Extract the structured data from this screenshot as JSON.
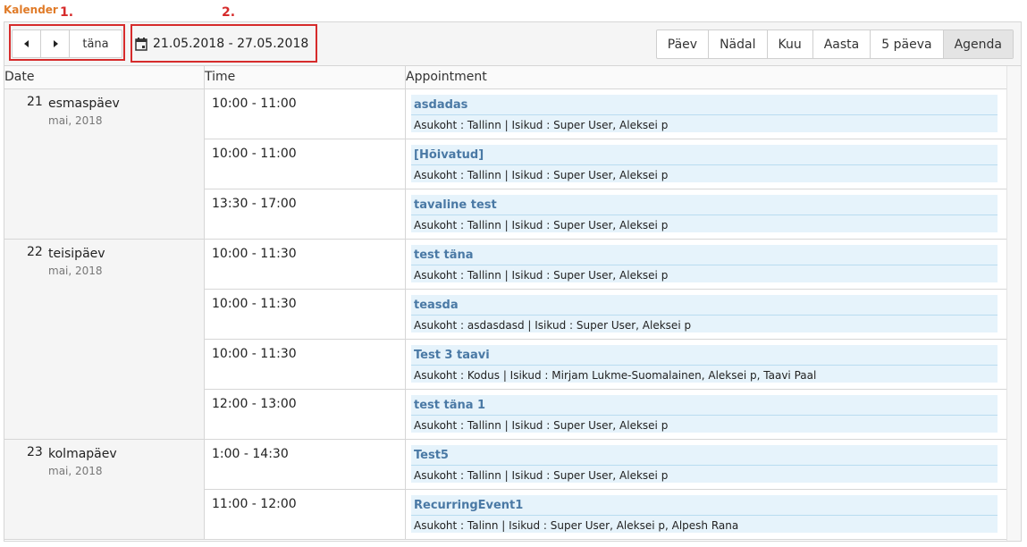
{
  "app_title": "Kalender",
  "annotations": {
    "label1": "1.",
    "label2": "2."
  },
  "toolbar": {
    "prev_icon": "triangle-left-icon",
    "next_icon": "triangle-right-icon",
    "today_label": "täna",
    "date_range": "21.05.2018 - 27.05.2018",
    "views": [
      {
        "label": "Päev",
        "active": false
      },
      {
        "label": "Nädal",
        "active": false
      },
      {
        "label": "Kuu",
        "active": false
      },
      {
        "label": "Aasta",
        "active": false
      },
      {
        "label": "5 päeva",
        "active": false
      },
      {
        "label": "Agenda",
        "active": true
      }
    ]
  },
  "columns": {
    "date": "Date",
    "time": "Time",
    "appointment": "Appointment"
  },
  "days": [
    {
      "num": "21",
      "name": "esmaspäev",
      "month": "mai, 2018",
      "events": [
        {
          "time": "10:00 - 11:00",
          "title": "asdadas",
          "desc": "Asukoht : Tallinn | Isikud : Super User, Aleksei p"
        },
        {
          "time": "10:00 - 11:00",
          "title": "[Hõivatud]",
          "desc": "Asukoht : Tallinn | Isikud : Super User, Aleksei p"
        },
        {
          "time": "13:30 - 17:00",
          "title": "tavaline test",
          "desc": "Asukoht : Tallinn | Isikud : Super User, Aleksei p"
        }
      ]
    },
    {
      "num": "22",
      "name": "teisipäev",
      "month": "mai, 2018",
      "events": [
        {
          "time": "10:00 - 11:30",
          "title": "test täna",
          "desc": "Asukoht : Tallinn | Isikud : Super User, Aleksei p"
        },
        {
          "time": "10:00 - 11:30",
          "title": "teasda",
          "desc": "Asukoht : asdasdasd | Isikud : Super User, Aleksei p"
        },
        {
          "time": "10:00 - 11:30",
          "title": "Test 3 taavi",
          "desc": "Asukoht : Kodus | Isikud : Mirjam Lukme-Suomalainen, Aleksei p, Taavi Paal"
        },
        {
          "time": "12:00 - 13:00",
          "title": "test täna 1",
          "desc": "Asukoht : Tallinn | Isikud : Super User, Aleksei p"
        }
      ]
    },
    {
      "num": "23",
      "name": "kolmapäev",
      "month": "mai, 2018",
      "events": [
        {
          "time": "1:00 - 14:30",
          "title": "Test5",
          "desc": "Asukoht : Tallinn | Isikud : Super User, Aleksei p"
        },
        {
          "time": "11:00 - 12:00",
          "title": "RecurringEvent1",
          "desc": "Asukoht : Talinn | Isikud : Super User, Aleksei p, Alpesh Rana"
        }
      ]
    }
  ]
}
